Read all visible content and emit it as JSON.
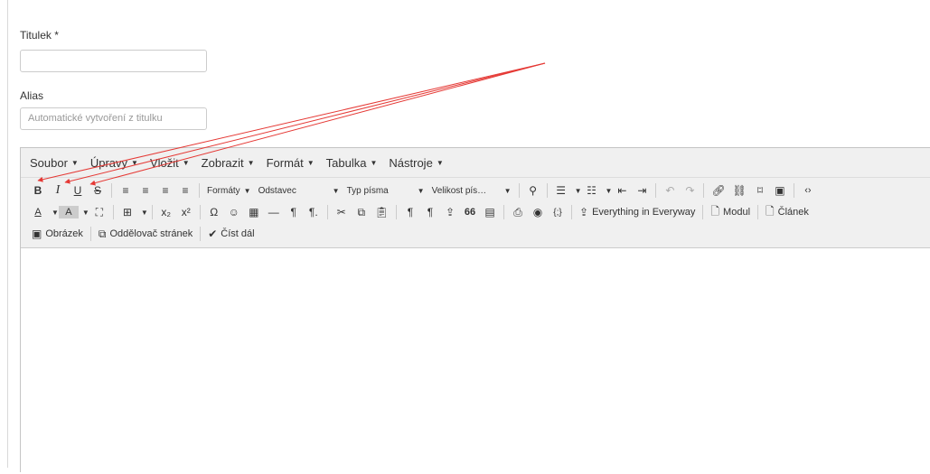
{
  "form": {
    "title_label": "Titulek *",
    "title_value": "",
    "alias_label": "Alias",
    "alias_placeholder": "Automatické vytvoření z titulku"
  },
  "menubar": [
    "Soubor",
    "Úpravy",
    "Vložit",
    "Zobrazit",
    "Formát",
    "Tabulka",
    "Nástroje"
  ],
  "toolbar": {
    "formats": "Formáty",
    "block": "Odstavec",
    "font": "Typ písma",
    "font_size": "Velikost pís…",
    "everything": "Everything in Everyway",
    "module": "Modul",
    "article": "Článek",
    "image": "Obrázek",
    "pagebreak": "Oddělovač stránek",
    "readmore": "Číst dál"
  },
  "icons": {
    "bold": "B",
    "italic": "I",
    "underline": "U",
    "strike": "S",
    "omega": "Ω",
    "smiley": "☺",
    "hr": "—",
    "pilcrow": "¶",
    "quote": "66"
  },
  "annotation": {
    "arrow_color": "#e53935"
  }
}
